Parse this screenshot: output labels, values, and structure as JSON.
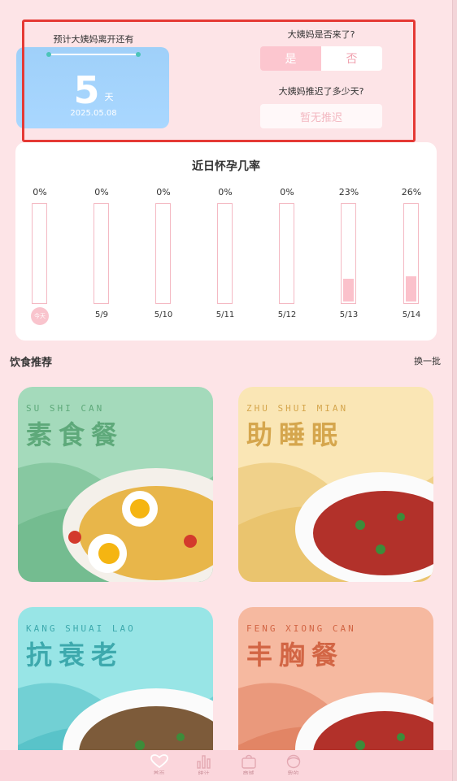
{
  "period": {
    "title": "预计大姨妈离开还有",
    "days": "5",
    "unit": "天",
    "date": "2025.05.08"
  },
  "questions": {
    "arrived_label": "大姨妈是否来了?",
    "yes": "是",
    "no": "否",
    "selected": "是",
    "delay_label": "大姨妈推迟了多少天?",
    "delay_button": "暂无推迟"
  },
  "probability": {
    "title": "近日怀孕几率",
    "today_label": "今天",
    "days": [
      {
        "label": "今天",
        "pct": "0%",
        "value": 0
      },
      {
        "label": "5/9",
        "pct": "0%",
        "value": 0
      },
      {
        "label": "5/10",
        "pct": "0%",
        "value": 0
      },
      {
        "label": "5/11",
        "pct": "0%",
        "value": 0
      },
      {
        "label": "5/12",
        "pct": "0%",
        "value": 0
      },
      {
        "label": "5/13",
        "pct": "23%",
        "value": 0.23
      },
      {
        "label": "5/14",
        "pct": "26%",
        "value": 0.26
      }
    ]
  },
  "diet": {
    "title": "饮食推荐",
    "refresh": "换一批",
    "cards": [
      {
        "pinyin": "SU SHI CAN",
        "name": "素食餐",
        "bg": "#a4dabb",
        "text": "#5ea97a"
      },
      {
        "pinyin": "ZHU SHUI MIAN",
        "name": "助睡眠",
        "bg": "#fae6b5",
        "text": "#d5a64d"
      },
      {
        "pinyin": "KANG SHUAI LAO",
        "name": "抗衰老",
        "bg": "#98e5e6",
        "text": "#3da9ad"
      },
      {
        "pinyin": "FENG XIONG CAN",
        "name": "丰胸餐",
        "bg": "#f6b9a0",
        "text": "#d26544"
      }
    ]
  },
  "nav": {
    "items": [
      {
        "icon": "heart-icon",
        "label": "首页"
      },
      {
        "icon": "chart-icon",
        "label": "统计"
      },
      {
        "icon": "bag-icon",
        "label": "商城"
      },
      {
        "icon": "face-icon",
        "label": "我的"
      }
    ]
  },
  "colors": {
    "background": "#fde4e7",
    "accent_pink": "#fcc6cf",
    "period_blue": "#a9d7ff",
    "annotation_red": "#e53935"
  }
}
